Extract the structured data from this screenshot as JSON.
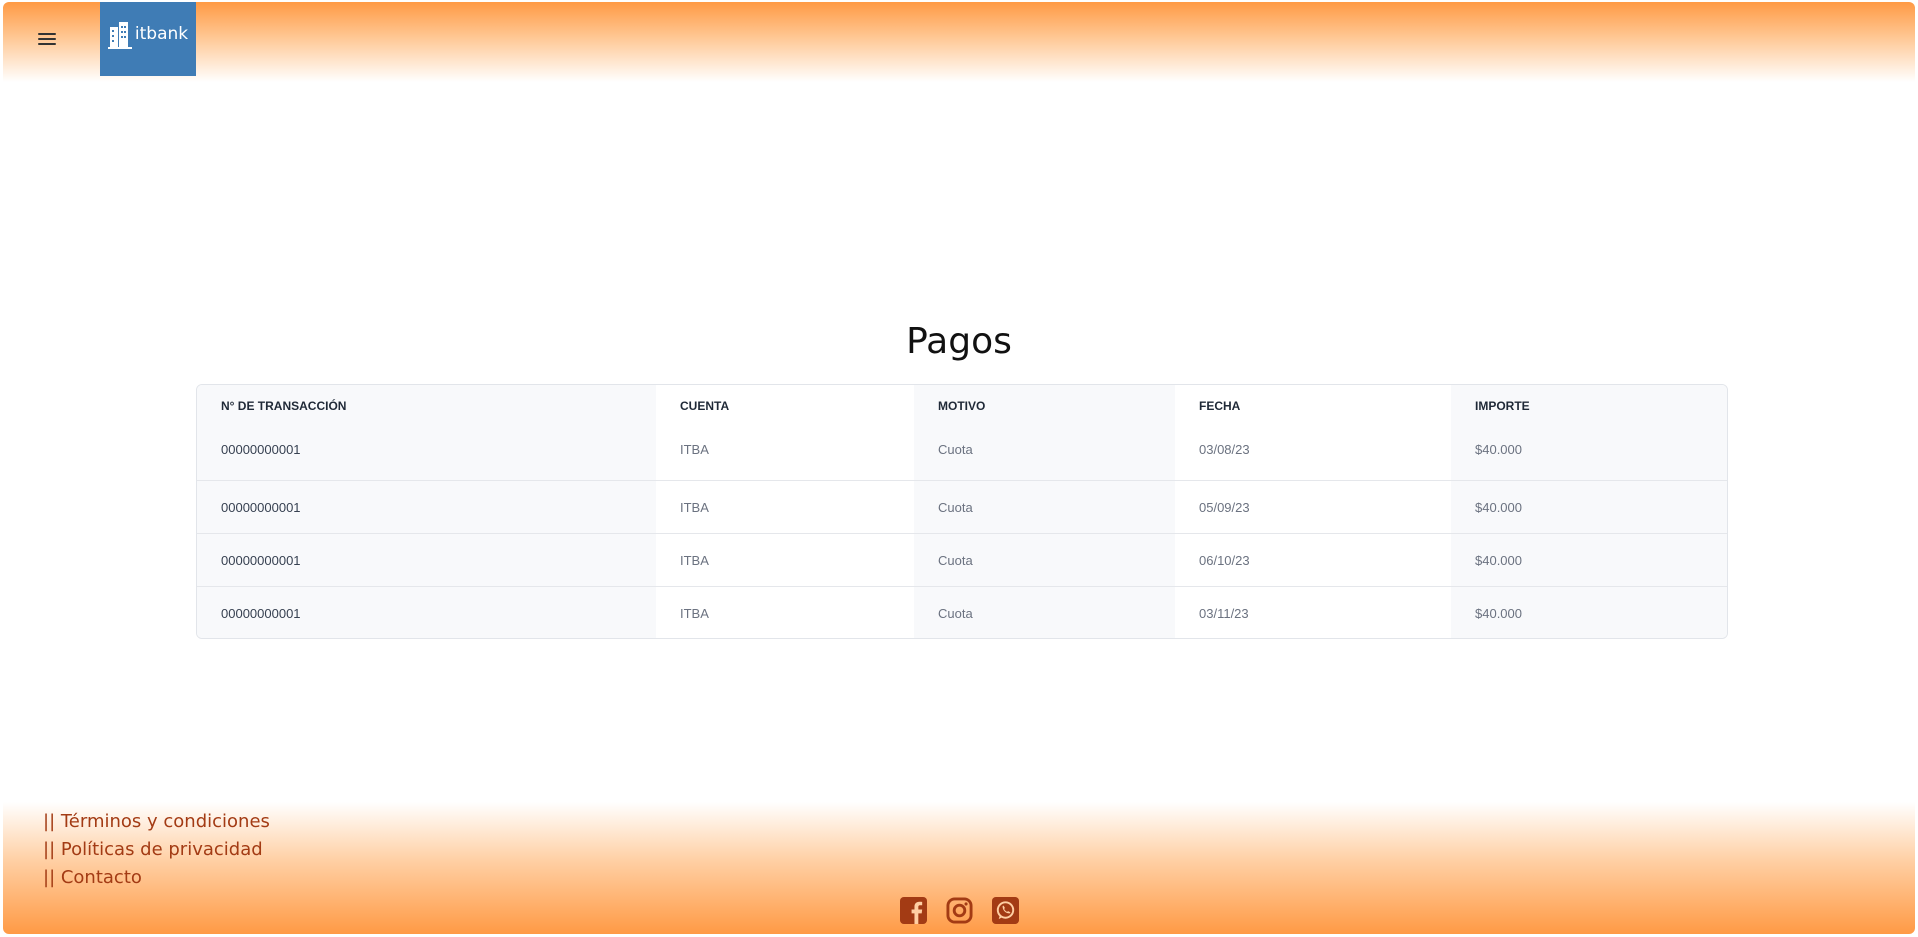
{
  "header": {
    "logo_text": "itbank"
  },
  "page": {
    "title": "Pagos"
  },
  "table": {
    "headers": [
      "N° DE TRANSACCIÓN",
      "CUENTA",
      "MOTIVO",
      "FECHA",
      "IMPORTE"
    ],
    "rows": [
      [
        "00000000001",
        "ITBA",
        "Cuota",
        "03/08/23",
        "$40.000"
      ],
      [
        "00000000001",
        "ITBA",
        "Cuota",
        "05/09/23",
        "$40.000"
      ],
      [
        "00000000001",
        "ITBA",
        "Cuota",
        "06/10/23",
        "$40.000"
      ],
      [
        "00000000001",
        "ITBA",
        "Cuota",
        "03/11/23",
        "$40.000"
      ]
    ]
  },
  "footer": {
    "links": [
      "|| Términos y condiciones",
      "|| Políticas de privacidad",
      "|| Contacto"
    ],
    "social_icons": [
      "facebook-icon",
      "instagram-icon",
      "whatsapp-icon"
    ]
  },
  "colors": {
    "accent_orange": "#ff9a45",
    "logo_blue": "#3f7cb5",
    "footer_link": "#a33b14"
  }
}
